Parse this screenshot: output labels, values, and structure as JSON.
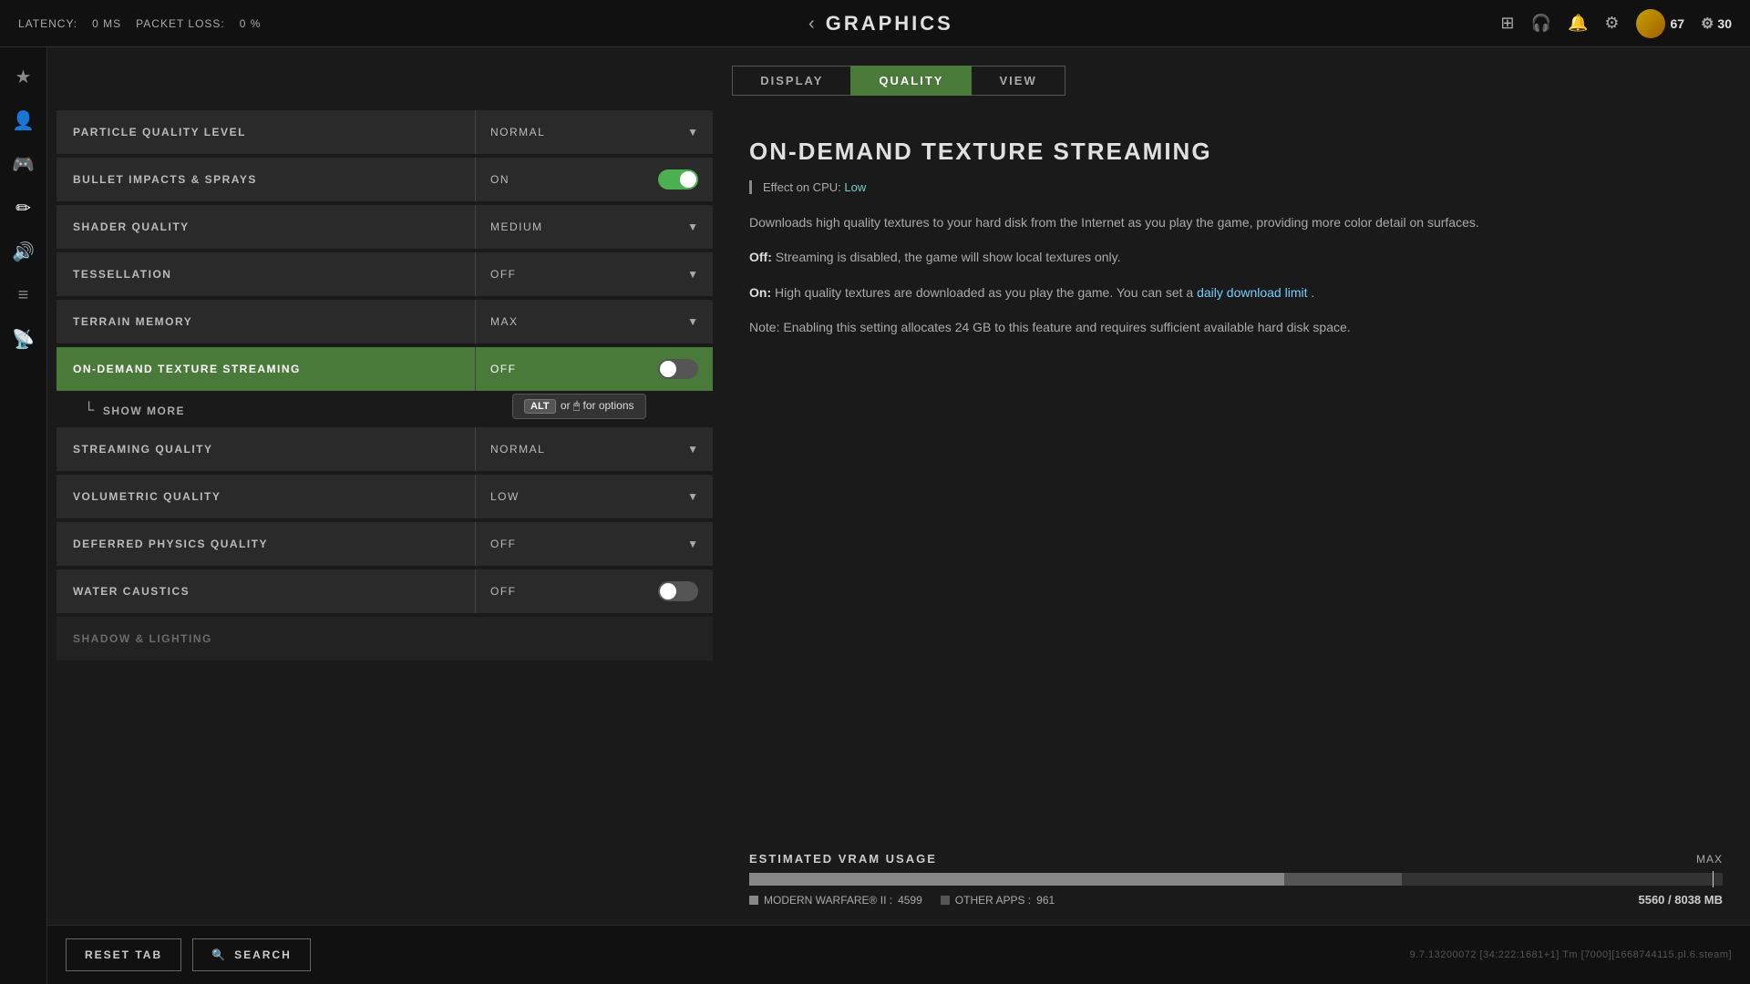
{
  "topbar": {
    "latency_label": "LATENCY:",
    "latency_value": "0 MS",
    "packet_loss_label": "PACKET LOSS:",
    "packet_loss_value": "0 %",
    "title": "GRAPHICS",
    "user_level": "67",
    "currency": "30",
    "back_label": "‹"
  },
  "sidebar": {
    "items": [
      {
        "icon": "★",
        "name": "favorites"
      },
      {
        "icon": "👤",
        "name": "profile"
      },
      {
        "icon": "🎮",
        "name": "controller"
      },
      {
        "icon": "✏️",
        "name": "edit"
      },
      {
        "icon": "🔊",
        "name": "audio"
      },
      {
        "icon": "≡",
        "name": "menu"
      },
      {
        "icon": "📡",
        "name": "network"
      }
    ]
  },
  "tabs": [
    {
      "label": "DISPLAY",
      "active": false
    },
    {
      "label": "QUALITY",
      "active": true
    },
    {
      "label": "VIEW",
      "active": false
    }
  ],
  "settings": [
    {
      "label": "PARTICLE QUALITY LEVEL",
      "value": "NORMAL",
      "type": "dropdown",
      "active": false
    },
    {
      "label": "BULLET IMPACTS & SPRAYS",
      "value": "ON",
      "type": "toggle",
      "toggle_on": true,
      "active": false
    },
    {
      "label": "SHADER QUALITY",
      "value": "MEDIUM",
      "type": "dropdown",
      "active": false
    },
    {
      "label": "TESSELLATION",
      "value": "OFF",
      "type": "dropdown",
      "active": false
    },
    {
      "label": "TERRAIN MEMORY",
      "value": "MAX",
      "type": "dropdown",
      "active": false
    },
    {
      "label": "ON-DEMAND TEXTURE STREAMING",
      "value": "OFF",
      "type": "toggle",
      "toggle_on": false,
      "active": true
    },
    {
      "label": "STREAMING QUALITY",
      "value": "NORMAL",
      "type": "dropdown",
      "active": false
    },
    {
      "label": "VOLUMETRIC QUALITY",
      "value": "LOW",
      "type": "dropdown",
      "active": false
    },
    {
      "label": "DEFERRED PHYSICS QUALITY",
      "value": "OFF",
      "type": "dropdown",
      "active": false
    },
    {
      "label": "WATER CAUSTICS",
      "value": "OFF",
      "type": "toggle",
      "toggle_on": false,
      "active": false
    },
    {
      "label": "SHADOW & LIGHTING",
      "value": "",
      "type": "section",
      "active": false
    }
  ],
  "show_more": {
    "label": "SHOW MORE"
  },
  "tooltip": {
    "alt_key": "ALT",
    "or_text": "or",
    "mouse_text": "🖱",
    "suffix": "for options"
  },
  "info_panel": {
    "title": "ON-DEMAND TEXTURE STREAMING",
    "cpu_effect_label": "Effect on CPU:",
    "cpu_effect_value": "Low",
    "description1": "Downloads high quality textures to your hard disk from the Internet as you play the game, providing more color detail on surfaces.",
    "description2_prefix": "Off:",
    "description2_body": "Streaming is disabled, the game will show local textures only.",
    "description3_prefix": "On:",
    "description3_body": " High quality textures are downloaded as you play the game. You can set a ",
    "description3_link": "daily download limit",
    "description3_end": ".",
    "note": "Note: Enabling this setting allocates 24 GB to this feature and requires sufficient available hard disk space."
  },
  "vram": {
    "label": "ESTIMATED VRAM USAGE",
    "max_label": "MAX",
    "game_label": "MODERN WARFARE® II :",
    "game_value": "4599",
    "other_label": "OTHER APPS :",
    "other_value": "961",
    "total": "5560 / 8038 MB",
    "used_pct": 55,
    "other_pct": 12
  },
  "bottom": {
    "reset_label": "RESET TAB",
    "search_label": "SEARCH",
    "version": "9.7.13200072 [34:222:1681+1] Tm [7000][1668744115.pl.6.steam]"
  }
}
